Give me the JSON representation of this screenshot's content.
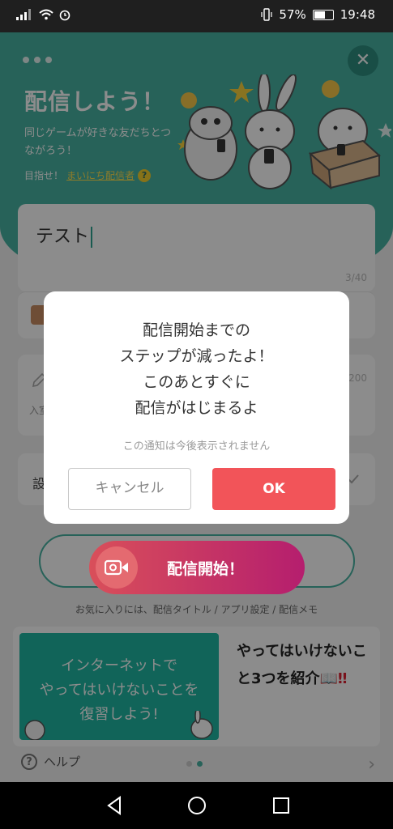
{
  "status_bar": {
    "battery": "57%",
    "time": "19:48"
  },
  "header": {
    "title": "配信しよう！",
    "subtitle": "同じゲームが好きな友だちとつながろう！",
    "goal_prefix": "目指せ！",
    "goal_link": "まいにち配信者",
    "help_mark": "?"
  },
  "form": {
    "title_value": "テスト",
    "title_count": "3/40",
    "desc_count": "200",
    "desc_hint": "入室",
    "settings_label": "設"
  },
  "start_button": {
    "label": "配信開始！"
  },
  "favorite_note": "お気に入りには、配信タイトル / アプリ設定 / 配信メモ",
  "banner": {
    "image_text_line1": "インターネットで",
    "image_text_line2": "やってはいけないことを",
    "image_text_line3": "復習しよう!",
    "side_text": "やってはいけないこと3つを紹介📖",
    "side_bang": "‼"
  },
  "help": {
    "label": "ヘルプ",
    "mark": "?"
  },
  "dialog": {
    "line1": "配信開始までの",
    "line2": "ステップが減ったよ！",
    "line3": "このあとすぐに",
    "line4": "配信がはじまるよ",
    "note": "この通知は今後表示されません",
    "cancel_label": "キャンセル",
    "ok_label": "OK"
  },
  "colors": {
    "teal": "#48b3a2",
    "ok": "#f25459",
    "start_grad_from": "#d94f5a",
    "start_grad_to": "#b51e6e"
  }
}
